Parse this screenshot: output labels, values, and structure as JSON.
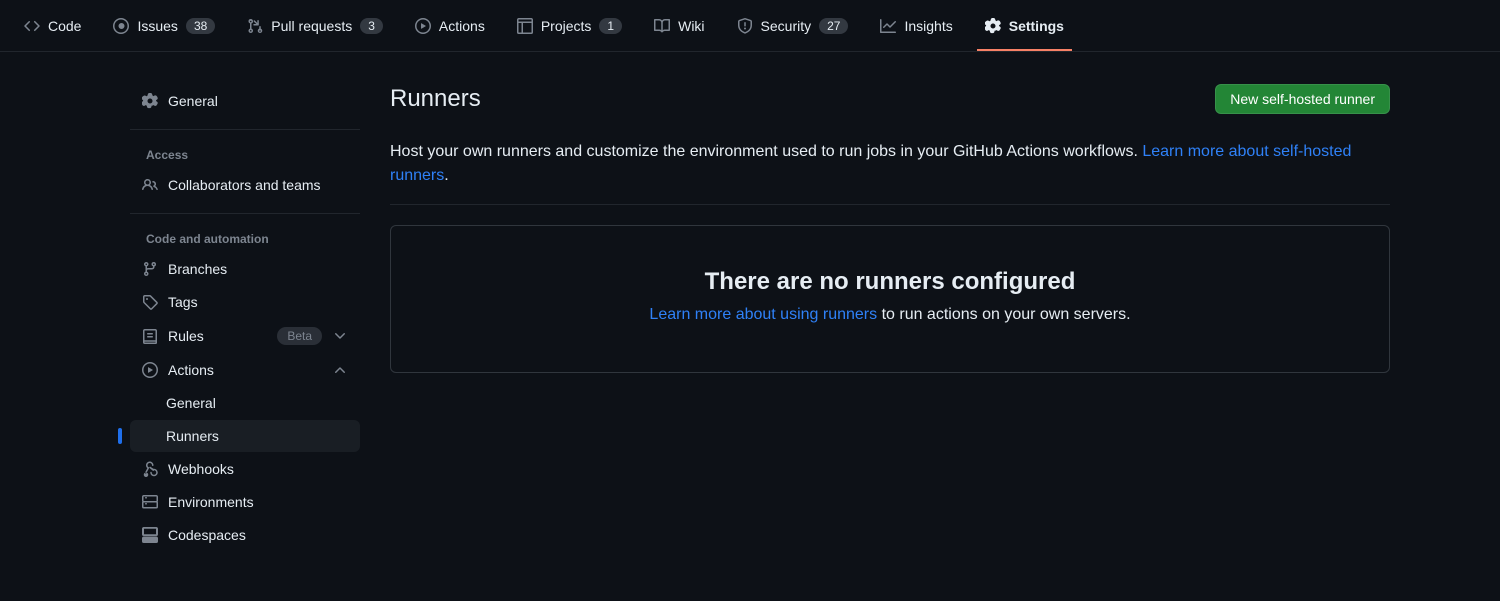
{
  "topnav": {
    "code": "Code",
    "issues": "Issues",
    "issues_count": "38",
    "pulls": "Pull requests",
    "pulls_count": "3",
    "actions": "Actions",
    "projects": "Projects",
    "projects_count": "1",
    "wiki": "Wiki",
    "security": "Security",
    "security_count": "27",
    "insights": "Insights",
    "settings": "Settings"
  },
  "sidebar": {
    "general": "General",
    "access_title": "Access",
    "collaborators": "Collaborators and teams",
    "automation_title": "Code and automation",
    "branches": "Branches",
    "tags": "Tags",
    "rules": "Rules",
    "rules_beta": "Beta",
    "actions": "Actions",
    "actions_general": "General",
    "actions_runners": "Runners",
    "webhooks": "Webhooks",
    "environments": "Environments",
    "codespaces": "Codespaces"
  },
  "main": {
    "title": "Runners",
    "new_runner_btn": "New self-hosted runner",
    "host_text": "Host your own runners and customize the environment used to run jobs in your GitHub Actions workflows. ",
    "learn_link": "Learn more about self-hosted runners",
    "period": ".",
    "empty_title": "There are no runners configured",
    "empty_link": "Learn more about using runners",
    "empty_suffix": " to run actions on your own servers."
  }
}
